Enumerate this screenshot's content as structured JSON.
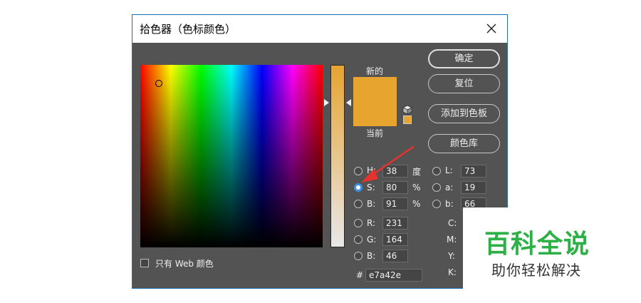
{
  "dialog": {
    "title": "拾色器（色标颜色）",
    "label_new": "新的",
    "label_current": "当前",
    "color_new": "#e7a42e",
    "color_current": "#e7a42e",
    "buttons": {
      "ok": "确定",
      "reset": "复位",
      "add_to_swatches": "添加到色板",
      "color_library": "颜色库"
    },
    "hsb": {
      "h_label": "H:",
      "h_value": "38",
      "h_unit": "度",
      "s_label": "S:",
      "s_value": "80",
      "s_unit": "%",
      "b_label": "B:",
      "b_value": "91",
      "b_unit": "%"
    },
    "rgb": {
      "r_label": "R:",
      "r_value": "231",
      "g_label": "G:",
      "g_value": "164",
      "b_label": "B:",
      "b_value": "46"
    },
    "lab": {
      "l_label": "L:",
      "l_value": "73",
      "a_label": "a:",
      "a_value": "19",
      "b_label": "b:",
      "b_value": "66"
    },
    "cmyk": {
      "c_label": "C:",
      "m_label": "M:",
      "y_label": "Y:",
      "k_label": "K:"
    },
    "hex_label": "#",
    "hex_value": "e7a42e",
    "web_only_label": "只有 Web 颜色",
    "selected_mode": "S"
  },
  "annotation": {
    "arrow_color": "#e8322c"
  },
  "watermark": {
    "main": "百科全说",
    "sub": "助你轻松解决",
    "color": "#2db046"
  }
}
